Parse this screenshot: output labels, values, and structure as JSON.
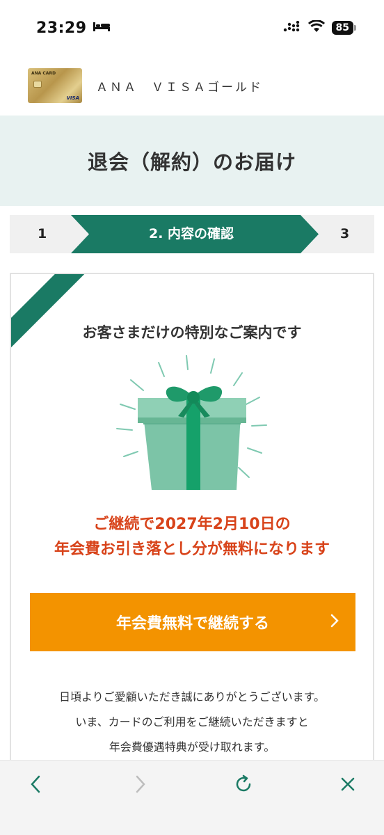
{
  "status": {
    "time": "23:29",
    "battery": "85"
  },
  "brand": {
    "card_label": "ANA CARD",
    "card_network": "VISA",
    "name": "ＡＮＡ　ＶＩＳＡゴールド"
  },
  "page": {
    "title": "退会（解約）のお届け"
  },
  "steps": {
    "step1": "1",
    "step2": "2. 内容の確認",
    "step3": "3",
    "active_color": "#1a7a64",
    "inactive_color": "#f0f0f0"
  },
  "offer": {
    "heading": "お客さまだけの特別なご案内です",
    "line1": "ご継続で2027年2月10日の",
    "line2": "年会費お引き落とし分が無料になります",
    "button_label": "年会費無料で継続する",
    "message_line1": "日頃よりご愛顧いただき誠にありがとうございます。",
    "message_line2": "いま、カードのご利用をご継続いただきますと",
    "message_line3": "年会費優遇特典が受け取れます。",
    "accent_color": "#d8431a",
    "button_color": "#f39300"
  },
  "toolbar": {
    "icons": [
      "back-icon",
      "forward-icon",
      "reload-icon",
      "close-icon"
    ]
  }
}
